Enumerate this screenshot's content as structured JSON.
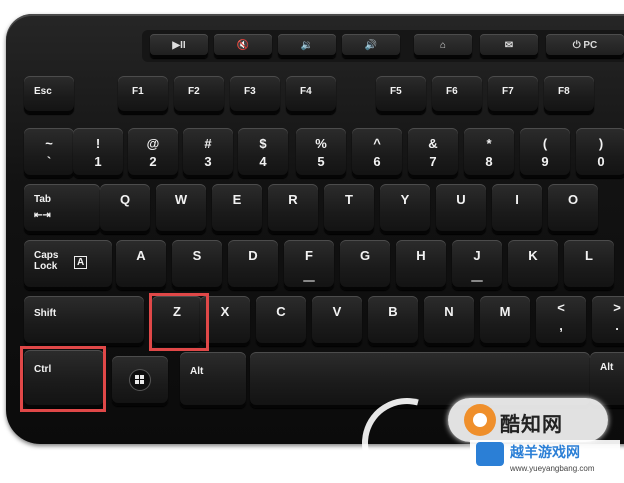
{
  "media_keys": [
    "▶II",
    "🔇",
    "🔉",
    "🔊",
    "⌂",
    "✉",
    "⏻ PC"
  ],
  "row0": {
    "esc": "Esc",
    "f1": "F1",
    "f2": "F2",
    "f3": "F3",
    "f4": "F4",
    "f5": "F5",
    "f6": "F6",
    "f7": "F7",
    "f8": "F8"
  },
  "row1": [
    {
      "top": "~",
      "bottom": "`"
    },
    {
      "top": "!",
      "bottom": "1"
    },
    {
      "top": "@",
      "bottom": "2"
    },
    {
      "top": "#",
      "bottom": "3"
    },
    {
      "top": "$",
      "bottom": "4"
    },
    {
      "top": "%",
      "bottom": "5"
    },
    {
      "top": "^",
      "bottom": "6"
    },
    {
      "top": "&",
      "bottom": "7"
    },
    {
      "top": "*",
      "bottom": "8"
    },
    {
      "top": "(",
      "bottom": "9"
    },
    {
      "top": ")",
      "bottom": "0"
    }
  ],
  "row2": {
    "tab": "Tab",
    "tab_symbol": "⇤⇥",
    "letters": [
      "Q",
      "W",
      "E",
      "R",
      "T",
      "Y",
      "U",
      "I",
      "O"
    ]
  },
  "row3": {
    "caps_line1": "Caps",
    "caps_line2": "Lock",
    "caps_symbol": "A",
    "letters": [
      "A",
      "S",
      "D",
      "F",
      "G",
      "H",
      "J",
      "K",
      "L"
    ]
  },
  "row4": {
    "shift": "Shift",
    "letters": [
      "Z",
      "X",
      "C",
      "V",
      "B",
      "N",
      "M"
    ],
    "comma_top": "<",
    "comma_bottom": ",",
    "period_top": ">",
    "period_bottom": "."
  },
  "row5": {
    "ctrl": "Ctrl",
    "alt_left": "Alt",
    "alt_right": "Alt"
  },
  "watermark": {
    "text": "酷知网",
    "brand": "越羊游戏网",
    "url": "www.yueyangbang.com"
  },
  "highlight_color": "#e04848"
}
